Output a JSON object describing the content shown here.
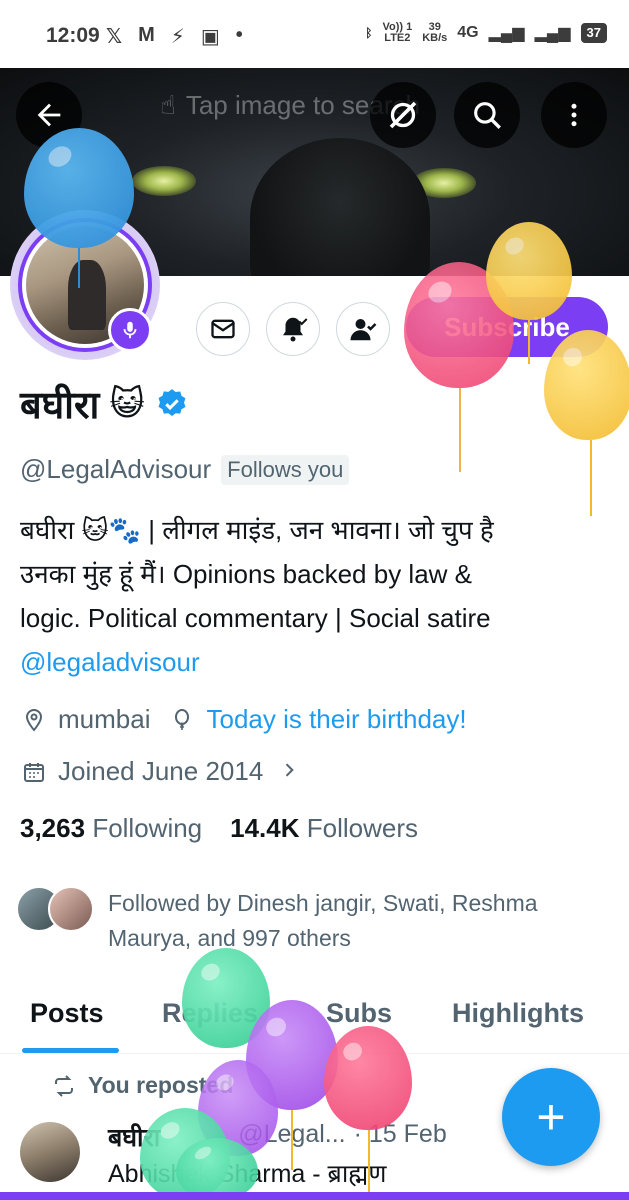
{
  "status_bar": {
    "time": "12:09",
    "left_icons": [
      "x-logo-icon",
      "gmail-icon",
      "signal-icon",
      "app-icon",
      "dot-icon"
    ],
    "network_label_top": "Vo)) 1",
    "network_label_bottom": "LTE2",
    "speed_top": "39",
    "speed_bottom": "KB/s",
    "network_type": "4G",
    "battery": "37"
  },
  "banner": {
    "hint_text": "Tap image to search"
  },
  "actions": {
    "subscribe_label": "Subscribe"
  },
  "profile": {
    "display_name": "बघीरा",
    "name_emoji": "😺",
    "handle": "@LegalAdvisour",
    "follows_you": "Follows you",
    "bio_line1": "बघीरा 🐱🐾 | लीगल माइंड, जन भावना। जो चुप है",
    "bio_line2": "उनका मुंह हूं मैं।  Opinions backed by law &",
    "bio_line3": "logic. Political commentary | Social satire",
    "bio_mention": "@legaladvisour",
    "location": "mumbai",
    "birthday": "Today is their birthday!",
    "joined": "Joined June 2014",
    "following_count": "3,263",
    "following_label": "Following",
    "followers_count": "14.4K",
    "followers_label": "Followers",
    "followed_by": "Followed by Dinesh jangir, Swati, Reshma Maurya, and 997 others"
  },
  "tabs": [
    {
      "label": "Posts"
    },
    {
      "label": "Replies"
    },
    {
      "label": "Subs"
    },
    {
      "label": "Highlights"
    }
  ],
  "post": {
    "repost_label": "You reposted",
    "author_name": "बघीरा",
    "author_handle": "@Legal...",
    "date": "· 15 Feb",
    "text": "Abhishek Sharma - ब्राह्मण"
  },
  "fab": {
    "label": "+"
  },
  "colors": {
    "accent": "#1d9bf0",
    "premium_purple": "#7b3ef2",
    "text_primary": "#0f1419",
    "text_secondary": "#536471"
  }
}
